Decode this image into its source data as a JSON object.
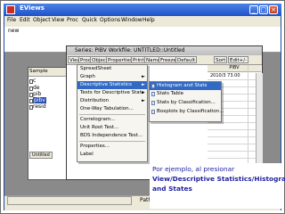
{
  "window": {
    "title": "EViews"
  },
  "menubar": [
    "File",
    "Edit",
    "Object",
    "View",
    "Proc",
    "Quick",
    "Options",
    "Window",
    "Help"
  ],
  "command_window": {
    "text": "new"
  },
  "workfile": {
    "sample_label": "Sample",
    "items": [
      "c",
      "de",
      "pib",
      "pibv",
      "resid"
    ],
    "selected_index": 3,
    "tab_label": "Untitled"
  },
  "series_window": {
    "title": "Series: PIBV   Workfile: UNTITLED::Untitled",
    "toolbar": [
      "View",
      "Proc",
      "Object",
      "Properties",
      "Print",
      "Name",
      "Freeze",
      "Default",
      "Sort",
      "Edit+/-"
    ],
    "column_header": "PIBV",
    "row_values": [
      "2010/3  73.00",
      "",
      "",
      "",
      "",
      "",
      "",
      "",
      "",
      "",
      "",
      "",
      "",
      ""
    ]
  },
  "view_menu": {
    "items": [
      "SpreadSheet",
      "Graph",
      "Descriptive Statistics",
      "Tests for Descriptive Stats",
      "Distribution",
      "One-Way Tabulation...",
      "Correlogram...",
      "Unit Root Test...",
      "BDS Independence Test...",
      "Properties...",
      "Label"
    ],
    "highlighted_index": 2,
    "submenu_indices": [
      1,
      2,
      3,
      4
    ]
  },
  "submenu": {
    "items": [
      "Histogram and Stats",
      "Stats Table",
      "Stats by Classification...",
      "Boxplots by Classification..."
    ],
    "highlighted_index": 0
  },
  "status_bar": {
    "path": "Path"
  },
  "caption": {
    "line1": "Por ejemplo, al presionar",
    "line2": "View/Descriptive Statistics/Histogram",
    "line3": "and States"
  },
  "colors": {
    "highlight": "#316ac5",
    "caption_text": "#1f1fa0",
    "title_bar": "#1f52c8"
  }
}
